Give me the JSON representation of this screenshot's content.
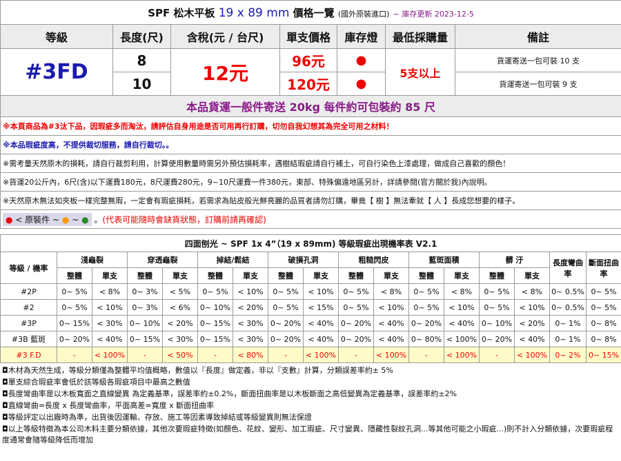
{
  "header": {
    "title_a": "SPF 松木平板",
    "title_size": "19 x 89 mm",
    "title_b": "價格一覽",
    "title_origin": "(國外原裝進口)",
    "title_update": "~ 庫存更新 2023-12-5"
  },
  "columns": [
    "等級",
    "長度(尺)",
    "含稅(元 / 台尺)",
    "單支價格",
    "庫存燈",
    "最低採購量",
    "備註"
  ],
  "product": {
    "grade": "#3FD",
    "price": "12元",
    "min_qty": "5支以上",
    "rows": [
      {
        "length": "8",
        "unit_price": "96元",
        "stock": "●",
        "note": "貨運寄送一包可裝 10 支"
      },
      {
        "length": "10",
        "unit_price": "120元",
        "stock": "●",
        "note": "貨運寄送一包可裝 9 支"
      }
    ]
  },
  "shipping_line": "本品貨運一般件寄送 20kg 每件約可包裝約 85 尺",
  "warnings": [
    "※本頁商品為#3汰下品，因瑕疵多而淘汰，請評估自身用途是否可用再行訂購，切勿自我幻想其為完全可用之材料！",
    "※本品瑕疵度高，不提供裁切服務，請自行裁切。。",
    "※需考量天然原木的損耗，請自行裁剪利用，計算使用數量時需另外預估損耗率，遇樹結瑕疵請自行補土，可自行染色上漆處理，做成自己喜歡的顏色！",
    "※貨運20公斤內，6尺(含)以下運費180元，8尺運費280元，9~10尺運費一件380元，東部、特殊偏遠地區另計，詳請參閱(官方關於我)內說明。",
    "※天然原木無法如夾板一樣完整無瑕，一定會有瑕疵損耗，若需求為貼皮般光鮮亮麗的品質者請勿訂購，畢竟【 樹 】無法牽就【 人 】長成您想要的樣子。"
  ],
  "legend": {
    "label": "< 原裝件",
    "tilde": "~",
    "notice": "(代表可能隨時會缺貨狀態，訂購前請再確認)",
    "dot_colors": [
      "#e00000",
      "#ff9900",
      "#228b22"
    ]
  },
  "defect_table": {
    "title": "四面刨光 ~ SPF 1x 4”（19 x 89mm) 等級瑕疵出現機率表 V2.1",
    "group_header": "等級 / 機率",
    "categories": [
      "淺龜裂",
      "穿透龜裂",
      "掉結/鬆結",
      "破損孔洞",
      "粗糙閃皮",
      "藍斑面積",
      "髒 汙"
    ],
    "extra_cols": [
      "長度彎曲率",
      "斷面扭曲率"
    ],
    "sub_a": "整體",
    "sub_b": "單支",
    "rows": [
      {
        "grade": "#2P",
        "cells": [
          "0~ 5%",
          "< 8%",
          "0~ 3%",
          "< 5%",
          "0~ 5%",
          "< 10%",
          "0~ 5%",
          "< 10%",
          "0~ 5%",
          "< 8%",
          "0~ 5%",
          "< 8%",
          "0~ 5%",
          "< 8%",
          "0~ 0.5%",
          "0~ 5%"
        ]
      },
      {
        "grade": "#2",
        "cells": [
          "0~ 5%",
          "< 10%",
          "0~ 3%",
          "< 6%",
          "0~ 10%",
          "< 20%",
          "0~ 5%",
          "< 15%",
          "0~ 5%",
          "< 10%",
          "0~ 5%",
          "< 10%",
          "0~ 5%",
          "< 10%",
          "0~ 0.5%",
          "0~ 5%"
        ]
      },
      {
        "grade": "#3P",
        "cells": [
          "0~ 15%",
          "< 30%",
          "0~ 10%",
          "< 20%",
          "0~ 15%",
          "< 30%",
          "0~ 20%",
          "< 40%",
          "0~ 20%",
          "< 40%",
          "0~ 20%",
          "< 40%",
          "0~ 10%",
          "< 20%",
          "0~ 1%",
          "0~ 8%"
        ]
      },
      {
        "grade": "#3B 藍斑",
        "cells": [
          "0~ 20%",
          "< 40%",
          "0~ 15%",
          "< 30%",
          "0~ 15%",
          "< 30%",
          "0~ 20%",
          "< 40%",
          "0~ 20%",
          "< 40%",
          "0~ 80%",
          "< 100%",
          "0~ 20%",
          "< 40%",
          "0~ 1%",
          "0~ 8%"
        ]
      },
      {
        "grade": "#3 F.D",
        "cells": [
          "-",
          "< 100%",
          "-",
          "< 50%",
          "-",
          "< 80%",
          "-",
          "< 100%",
          "-",
          "< 100%",
          "-",
          "< 100%",
          "-",
          "< 100%",
          "0~ 2%",
          "0~ 15%"
        ]
      }
    ]
  },
  "footnotes": [
    "◘木材為天然生成，等級分類僅為整體平均值概略，數值以『長度』做定義，非以『支數』計算，分類誤差率約± 5%",
    "◘單支綜合瑕疵率會低於該等級各瑕疵項目中最高之數值",
    "◘長度彎曲率是以木板寬面之直線變異 為定義基準，誤差率約±0.2%，斷面扭曲率是以木板斷面之高低變異為定義基準，誤差率約±2%",
    "◘直線彎曲=長度 x 長度彎曲率，平面高差=寬度 x 斷面扭曲率",
    "◘等級評定以出廠時為準，出貨後因運輸、存放、施工等因素導致掉結或等級變異則無法保證",
    "◘以上等級特徵為本公司木料主要分類依據，其他次要瑕疵特徵(如顏色、花紋、變形、加工瑕疵、尺寸變異、隱藏性裂紋孔洞...等其他可能之小瑕疵...)則不計入分類依據，次要瑕疵程度通常會隨等級降低而增加"
  ]
}
